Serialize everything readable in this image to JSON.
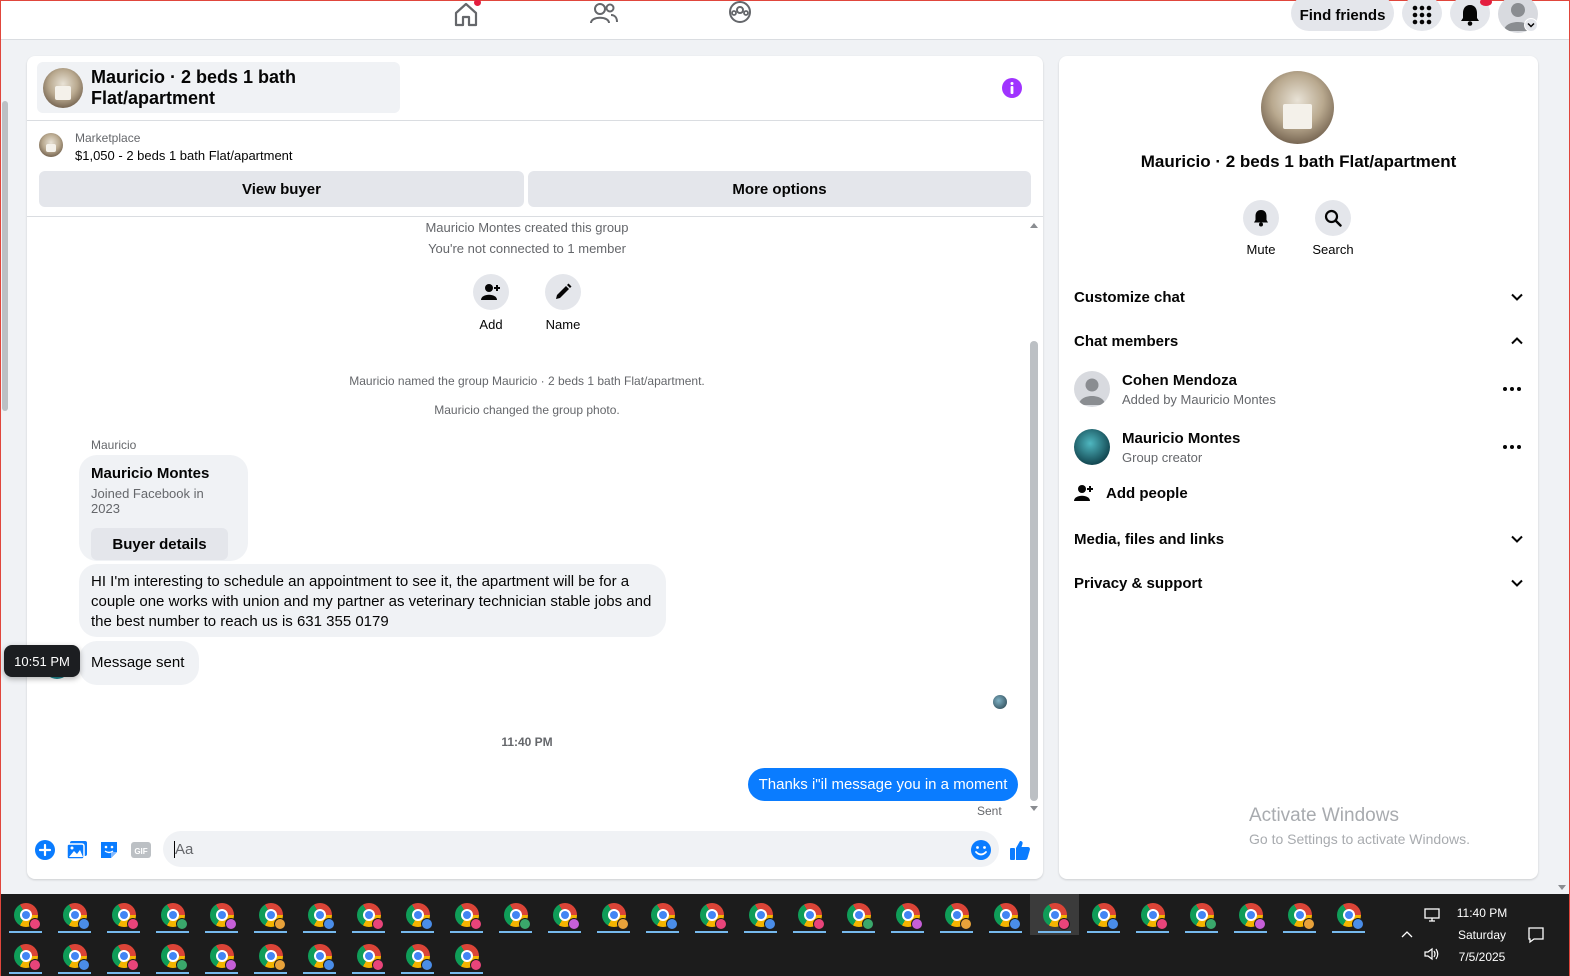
{
  "colors": {
    "accent": "#0a7cff",
    "purple_info": "#a033ff",
    "bg": "#f0f2f5",
    "taskbar": "#1c1c1c"
  },
  "topnav": {
    "find_friends": "Find friends",
    "icons": [
      "home-icon",
      "friends-icon",
      "groups-icon",
      "menu-grid-icon",
      "bell-icon",
      "profile-avatar"
    ]
  },
  "chat": {
    "title": "Mauricio · 2 beds 1 bath Flat/apartment",
    "listing": {
      "source": "Marketplace",
      "description": "$1,050 - 2 beds 1 bath Flat/apartment"
    },
    "buttons": {
      "view_buyer": "View buyer",
      "more_options": "More options"
    },
    "system": {
      "created": "Mauricio Montes created this group",
      "not_connected": "You're not connected to 1 member",
      "named": "Mauricio named the group Mauricio · 2 beds 1 bath Flat/apartment.",
      "photo": "Mauricio changed the group photo."
    },
    "actions": {
      "add": "Add",
      "name": "Name"
    },
    "sender_label": "Mauricio",
    "card": {
      "name": "Mauricio Montes",
      "sub": "Joined Facebook in 2023",
      "button": "Buyer details"
    },
    "message_long": "HI I'm interesting to schedule an appointment to see it, the apartment will be for a couple one works with union and my partner as veterinary technician stable jobs and the best number to reach us is 631 355 0179",
    "message_short": "Message sent",
    "tooltip_time": "10:51 PM",
    "time_separator": "11:40 PM",
    "my_message": "Thanks i\"il message you in a moment",
    "sent_label": "Sent",
    "composer_placeholder": "Aa"
  },
  "info": {
    "title": "Mauricio · 2 beds 1 bath Flat/apartment",
    "actions": {
      "mute": "Mute",
      "search": "Search"
    },
    "sections": {
      "customize": "Customize chat",
      "members": "Chat members",
      "media": "Media, files and links",
      "privacy": "Privacy & support"
    },
    "members": [
      {
        "name": "Cohen Mendoza",
        "sub": "Added by Mauricio Montes"
      },
      {
        "name": "Mauricio Montes",
        "sub": "Group creator"
      }
    ],
    "add_people": "Add people",
    "activate_title": "Activate Windows",
    "activate_sub": "Go to Settings to activate Windows."
  },
  "taskbar": {
    "time": "11:40 PM",
    "day": "Saturday",
    "date": "7/5/2025"
  }
}
